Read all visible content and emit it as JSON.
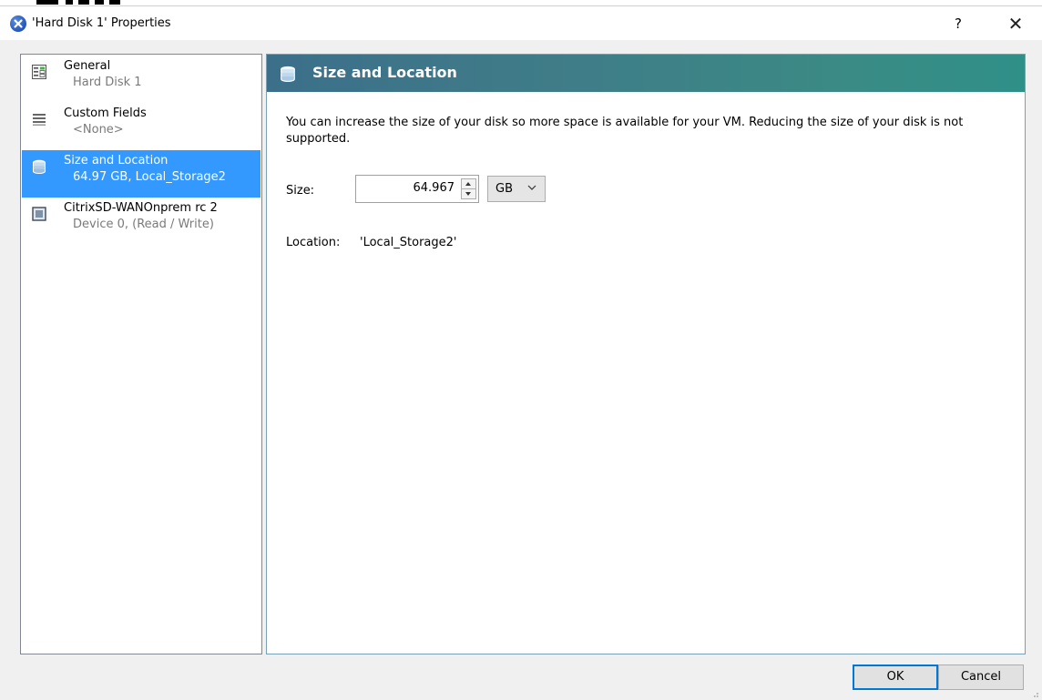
{
  "window": {
    "title": "'Hard Disk 1' Properties",
    "help_label": "?",
    "close_label": "✕"
  },
  "nav": {
    "items": [
      {
        "title": "General",
        "subtitle": "Hard Disk 1",
        "icon": "general-properties-icon"
      },
      {
        "title": "Custom Fields",
        "subtitle": "<None>",
        "icon": "custom-fields-icon"
      },
      {
        "title": "Size and Location",
        "subtitle": "64.97 GB, Local_Storage2",
        "icon": "storage-stack-icon",
        "selected": true
      },
      {
        "title": "CitrixSD-WANOnprem rc 2",
        "subtitle": "Device 0, (Read / Write)",
        "icon": "vm-device-icon"
      }
    ]
  },
  "content": {
    "header_title": "Size and Location",
    "description": "You can increase the size of your disk so more space is available for your VM. Reducing the size of your disk is not supported.",
    "size_label": "Size:",
    "size_value": "64.967",
    "unit_value": "GB",
    "location_label": "Location:",
    "location_value": "'Local_Storage2'"
  },
  "buttons": {
    "ok": "OK",
    "cancel": "Cancel"
  },
  "colors": {
    "header_start": "#3c6f8a",
    "header_end": "#2f9088",
    "selection": "#3399ff",
    "ok_border": "#0078d7"
  }
}
